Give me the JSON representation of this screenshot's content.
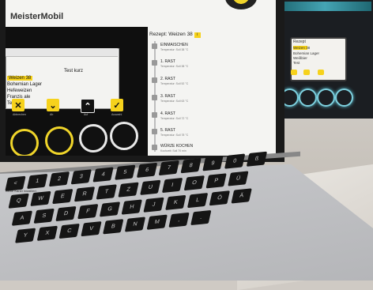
{
  "app": {
    "title": "MeisterMobil"
  },
  "device_screen": {
    "title": "Rezept",
    "lines": [
      "Weizen 38",
      "Bohemian Lager",
      "Weißbier",
      "Test"
    ]
  },
  "simulator": {
    "window_title": "",
    "menu": [
      "Weizen 38",
      "Bohemian Lager",
      "Hefeweizen",
      "Franzis ale",
      "Test"
    ],
    "selected": "Weizen 38",
    "right_text": "Test kurz",
    "buttons": [
      {
        "icon": "close-icon",
        "glyph": "✕",
        "label": "Abbrechen"
      },
      {
        "icon": "down-icon",
        "glyph": "⌄",
        "label": "Ab"
      },
      {
        "icon": "up-icon",
        "glyph": "⌃",
        "label": "Auf"
      },
      {
        "icon": "check-icon",
        "glyph": "✓",
        "label": "Auswahl"
      }
    ],
    "status": "Keine Kartei installiert"
  },
  "recipe": {
    "title": "Rezept: Weizen 38",
    "title_badge": "i",
    "steps": [
      {
        "name": "EINMAISCHEN",
        "sub": "Temperatur: Soll 38 °C"
      },
      {
        "name": "1. RAST",
        "sub": "Temperatur: Soll 38 °C"
      },
      {
        "name": "2. RAST",
        "sub": "Temperatur: Soll 52 °C"
      },
      {
        "name": "3. RAST",
        "sub": "Temperatur: Soll 63 °C"
      },
      {
        "name": "4. RAST",
        "sub": "Temperatur: Soll 72 °C"
      },
      {
        "name": "5. RAST",
        "sub": "Temperatur: Soll 78 °C"
      },
      {
        "name": "WÜRZE KOCHEN",
        "sub": "Kochzeit: Soll 70 min"
      }
    ]
  },
  "keyboard": {
    "row1": [
      "<",
      "1",
      "2",
      "3",
      "4",
      "5",
      "6",
      "7",
      "8",
      "9",
      "0",
      "ß"
    ],
    "row2": [
      "Q",
      "W",
      "E",
      "R",
      "T",
      "Z",
      "U",
      "I",
      "O",
      "P",
      "Ü"
    ],
    "row3": [
      "A",
      "S",
      "D",
      "F",
      "G",
      "H",
      "J",
      "K",
      "L",
      "Ö",
      "Ä"
    ],
    "row4": [
      "Y",
      "X",
      "C",
      "V",
      "B",
      "N",
      "M",
      ",",
      "."
    ]
  },
  "colors": {
    "accent": "#f6d21c",
    "ring_glow": "#7fd2e0"
  }
}
